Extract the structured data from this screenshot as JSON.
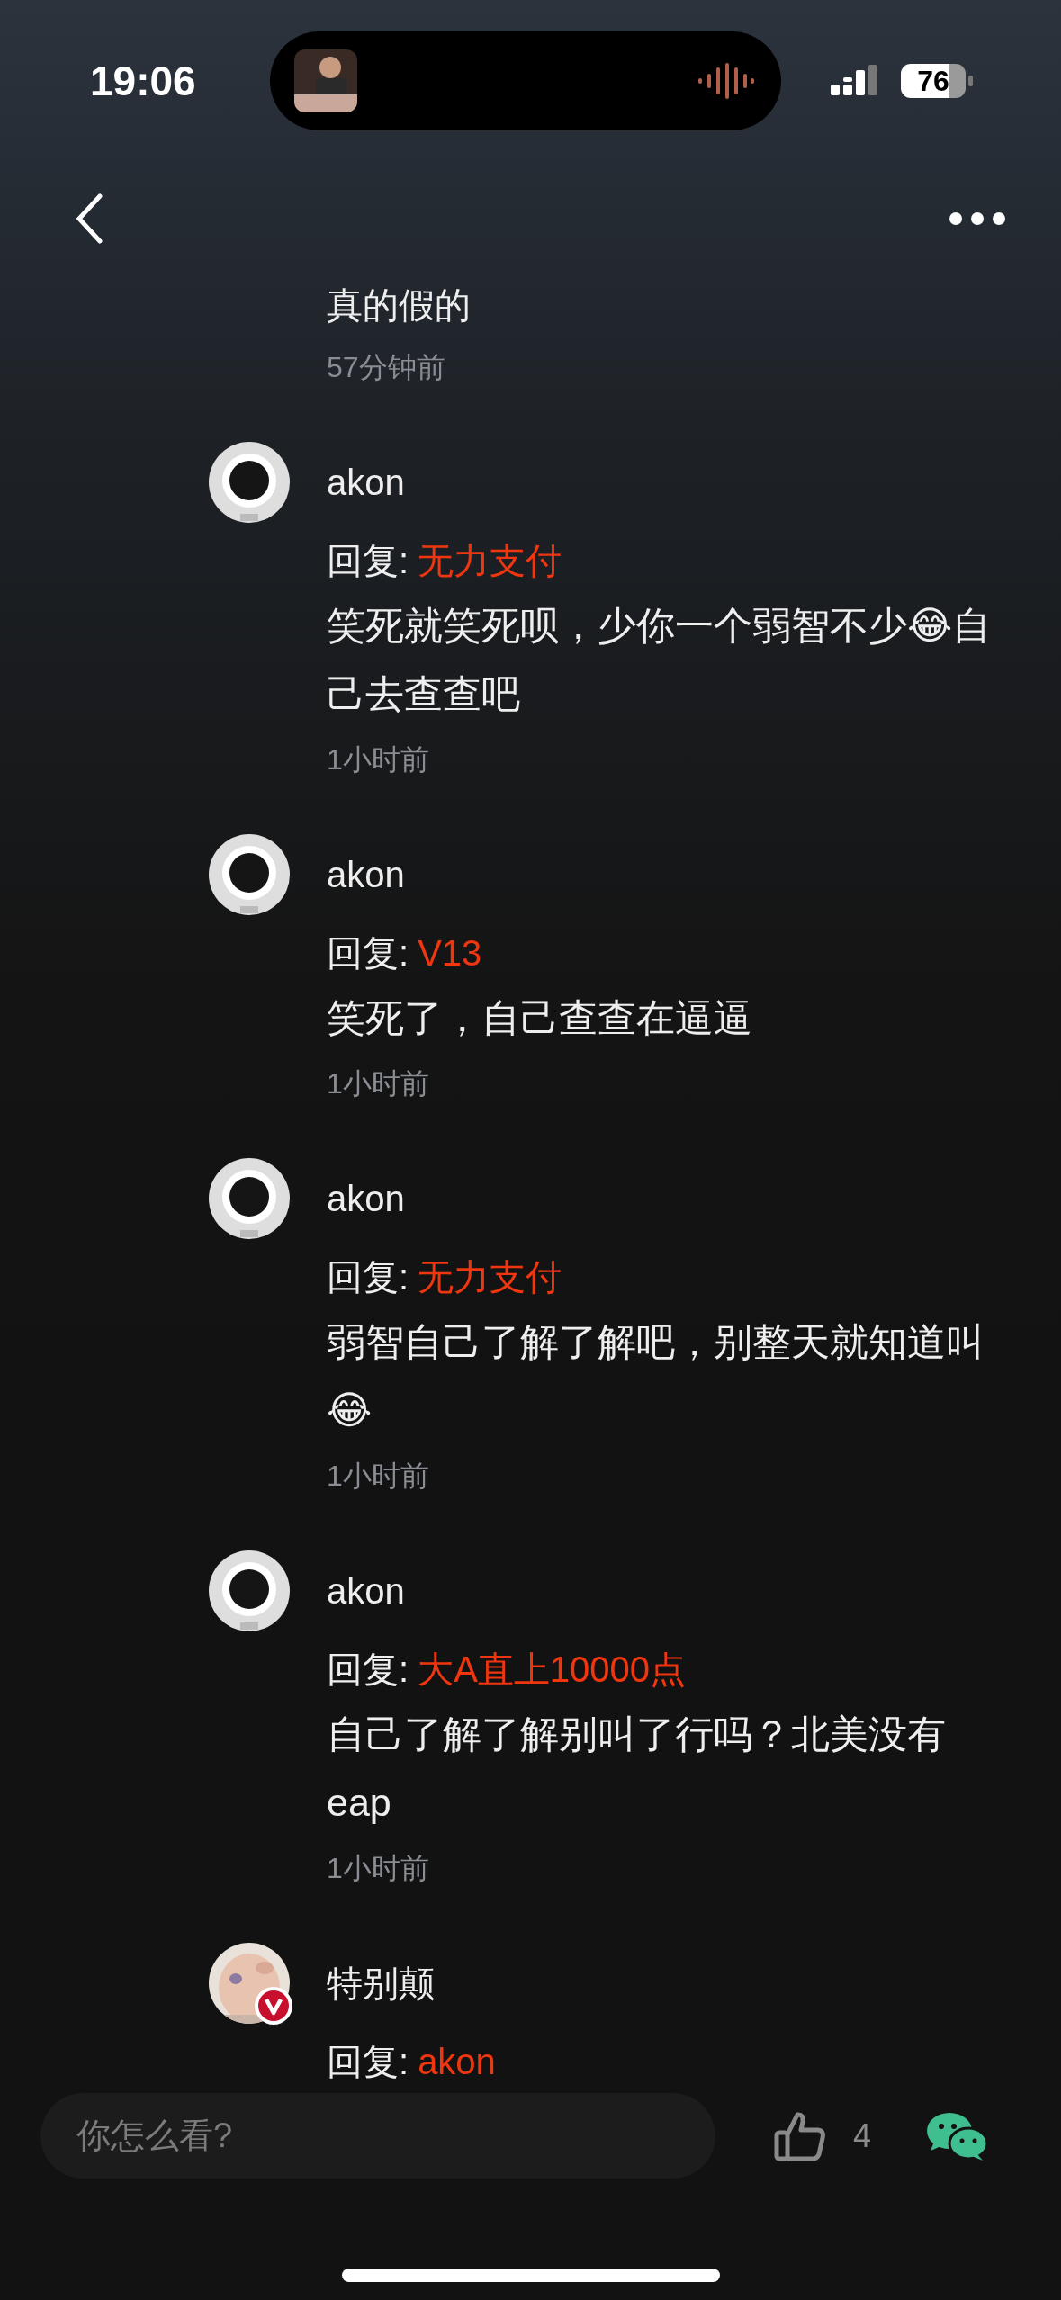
{
  "status_bar": {
    "time": "19:06",
    "battery": "76"
  },
  "parent_comment": {
    "text": "真的假的",
    "time": "57分钟前"
  },
  "replies": [
    {
      "author": "akon",
      "kind": "default",
      "verified": false,
      "reply_label": "回复:",
      "reply_to": "无力支付",
      "text": "笑死就笑死呗，少你一个弱智不少😂自己去查查吧",
      "time": "1小时前"
    },
    {
      "author": "akon",
      "kind": "default",
      "verified": false,
      "reply_label": "回复:",
      "reply_to": "V13",
      "text": "笑死了，自己查查在逼逼",
      "time": "1小时前"
    },
    {
      "author": "akon",
      "kind": "default",
      "verified": false,
      "reply_label": "回复:",
      "reply_to": "无力支付",
      "text": "弱智自己了解了解吧，别整天就知道叫😂",
      "time": "1小时前"
    },
    {
      "author": "akon",
      "kind": "default",
      "verified": false,
      "reply_label": "回复:",
      "reply_to": "大A直上10000点",
      "text": "自己了解了解别叫了行吗？北美没有eap",
      "time": "1小时前"
    },
    {
      "author": "特别颠",
      "verified": true,
      "reply_label": "回复:",
      "reply_to": "akon"
    }
  ],
  "composer": {
    "placeholder": "你怎么看?",
    "likes": "4"
  }
}
